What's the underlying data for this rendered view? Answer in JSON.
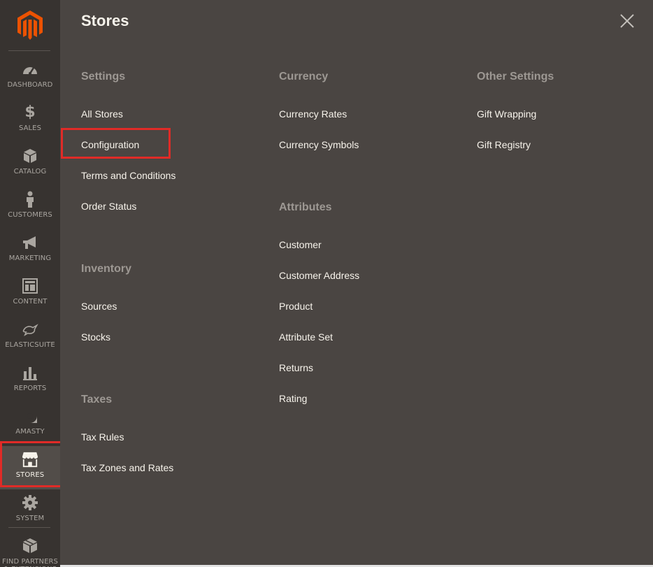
{
  "colors": {
    "sidebar_bg": "#373330",
    "panel_bg": "#4a4542",
    "brand_orange": "#eb5202",
    "highlight_red": "#e02b27",
    "text_light": "#f7f3eb",
    "section_title": "#9d9893"
  },
  "sidebar": {
    "logo_icon": "magento-logo-icon",
    "items": [
      {
        "label": "DASHBOARD",
        "icon": "dashboard-icon"
      },
      {
        "label": "SALES",
        "icon": "dollar-icon"
      },
      {
        "label": "CATALOG",
        "icon": "cube-icon"
      },
      {
        "label": "CUSTOMERS",
        "icon": "person-icon"
      },
      {
        "label": "MARKETING",
        "icon": "megaphone-icon"
      },
      {
        "label": "CONTENT",
        "icon": "layout-icon"
      },
      {
        "label": "ELASTICSUITE",
        "icon": "elasticsuite-icon"
      },
      {
        "label": "REPORTS",
        "icon": "bar-chart-icon"
      },
      {
        "label": "AMASTY",
        "icon": "amasty-icon"
      },
      {
        "label": "STORES",
        "icon": "store-icon",
        "active": true
      },
      {
        "label": "SYSTEM",
        "icon": "gear-icon"
      },
      {
        "label": "FIND PARTNERS & EXTENSIONS",
        "icon": "boxes-icon"
      }
    ]
  },
  "panel": {
    "title": "Stores",
    "close_icon": "close-icon",
    "columns": [
      {
        "sections": [
          {
            "title": "Settings",
            "links": [
              "All Stores",
              "Configuration",
              "Terms and Conditions",
              "Order Status"
            ]
          },
          {
            "title": "Inventory",
            "links": [
              "Sources",
              "Stocks"
            ]
          },
          {
            "title": "Taxes",
            "links": [
              "Tax Rules",
              "Tax Zones and Rates"
            ]
          }
        ]
      },
      {
        "sections": [
          {
            "title": "Currency",
            "links": [
              "Currency Rates",
              "Currency Symbols"
            ]
          },
          {
            "title": "Attributes",
            "links": [
              "Customer",
              "Customer Address",
              "Product",
              "Attribute Set",
              "Returns",
              "Rating"
            ]
          }
        ]
      },
      {
        "sections": [
          {
            "title": "Other Settings",
            "links": [
              "Gift Wrapping",
              "Gift Registry"
            ]
          }
        ]
      }
    ]
  }
}
